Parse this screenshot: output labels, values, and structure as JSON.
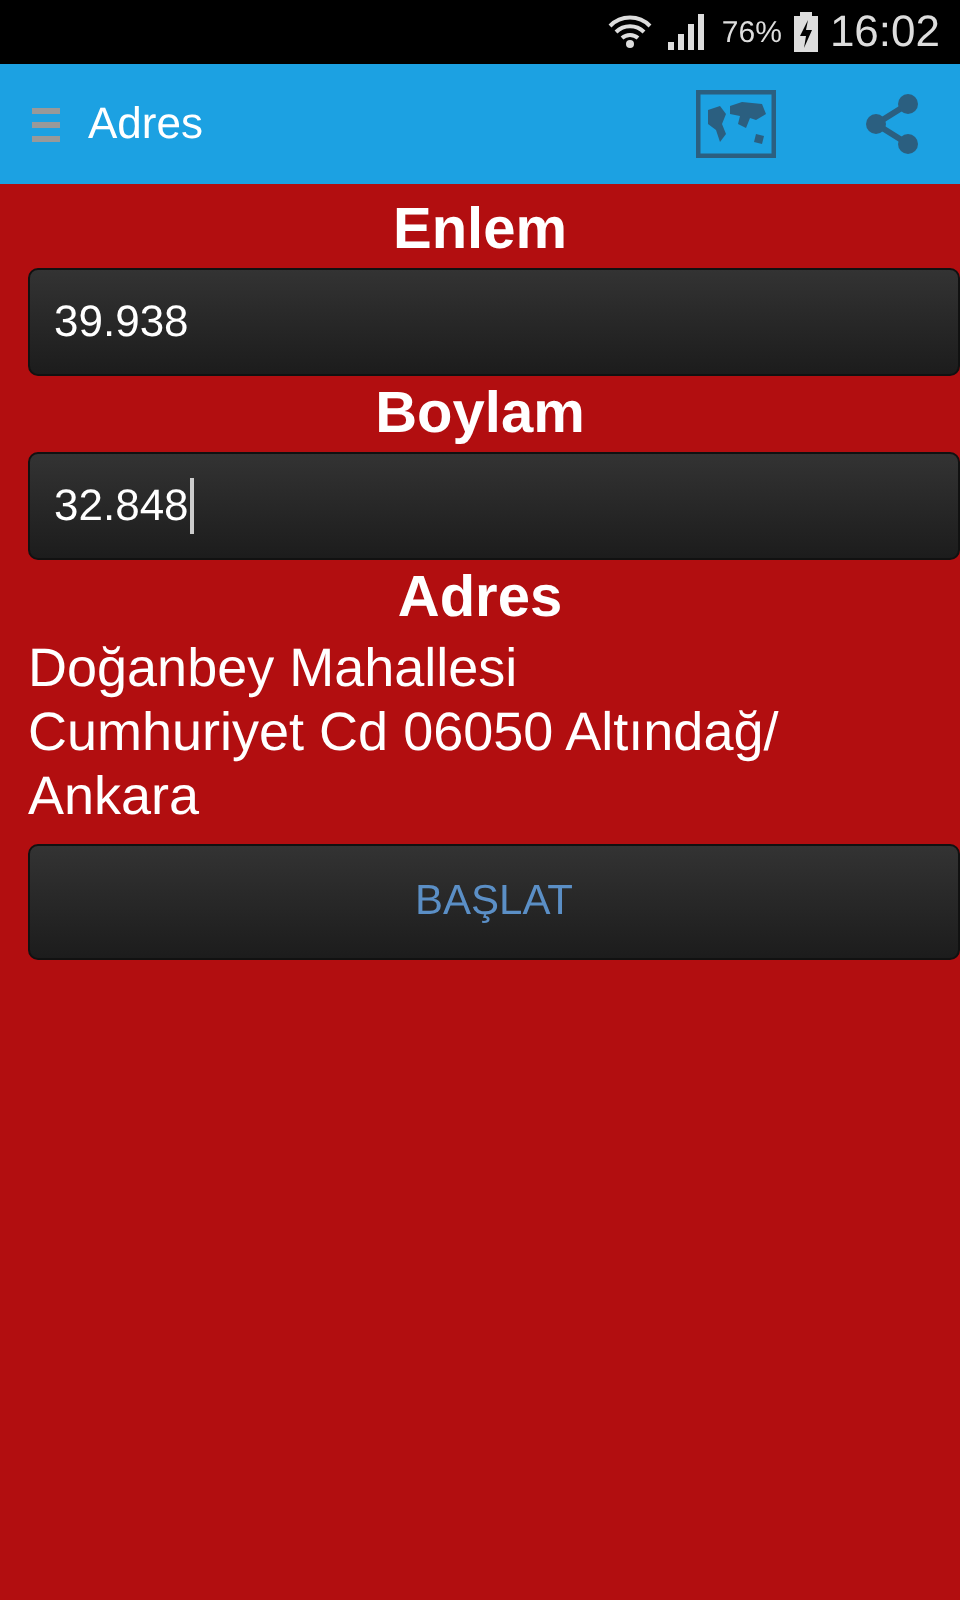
{
  "status_bar": {
    "battery": "76%",
    "time": "16:02"
  },
  "app_bar": {
    "title": "Adres"
  },
  "fields": [
    {
      "label": "Enlem",
      "value": "39.938",
      "focused": false
    },
    {
      "label": "Boylam",
      "value": "32.848",
      "focused": true
    }
  ],
  "address": {
    "label": "Adres",
    "lines": [
      "Doğanbey Mahallesi",
      "Cumhuriyet Cd 06050 Altındağ/",
      "Ankara"
    ]
  },
  "buttons": [
    "BAŞLAT"
  ]
}
